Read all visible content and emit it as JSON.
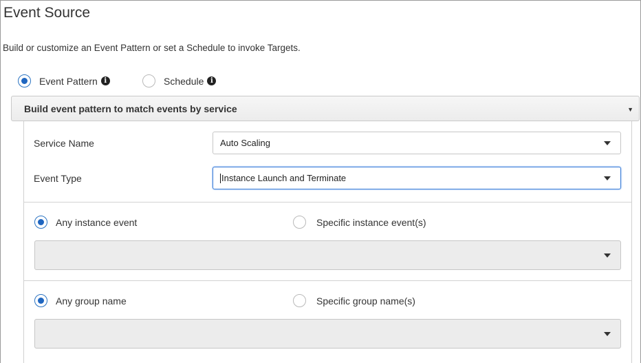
{
  "section": {
    "title": "Event Source",
    "description": "Build or customize an Event Pattern or set a Schedule to invoke Targets."
  },
  "source_type": {
    "options": [
      {
        "label": "Event Pattern",
        "selected": true,
        "info_icon": "info-icon"
      },
      {
        "label": "Schedule",
        "selected": false,
        "info_icon": "info-icon"
      }
    ]
  },
  "builder": {
    "header": "Build event pattern to match events by service",
    "service_name": {
      "label": "Service Name",
      "value": "Auto Scaling"
    },
    "event_type": {
      "label": "Event Type",
      "value": "Instance Launch and Terminate"
    }
  },
  "instance_event": {
    "any_label": "Any instance event",
    "specific_label": "Specific instance event(s)",
    "selected": "any",
    "dropdown_value": ""
  },
  "group_name": {
    "any_label": "Any group name",
    "specific_label": "Specific group name(s)",
    "selected": "any",
    "dropdown_value": ""
  },
  "colors": {
    "radio_selected": "#1f66c0",
    "focus_border": "#3b7dd8",
    "disabled_bg": "#ececec"
  }
}
